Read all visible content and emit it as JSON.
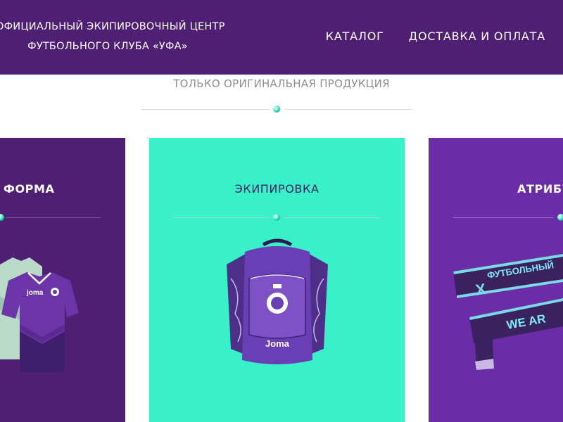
{
  "header": {
    "tagline_line1": "ОФИЦИАЛЬНЫЙ ЭКИПИРОВОЧНЫЙ ЦЕНТР",
    "tagline_line2": "ФУТБОЛЬНОГО КЛУБА «УФА»",
    "nav": [
      {
        "label": "КАТАЛОГ"
      },
      {
        "label": "ДОСТАВКА И ОПЛАТА"
      }
    ]
  },
  "section": {
    "subtitle": "ТОЛЬКО ОРИГИНАЛЬНАЯ ПРОДУКЦИЯ"
  },
  "cards": [
    {
      "title": "ФОРМА",
      "color": "#4f1f73"
    },
    {
      "title": "ЭКИПИРОВКА",
      "color": "#38f1c8"
    },
    {
      "title": "АТРИБУ",
      "color": "#6b2da7"
    }
  ],
  "images": {
    "kit_brand": "joma",
    "backpack_brand": "Joma",
    "scarf_text_1": "ФУТБОЛЬНЫЙ",
    "scarf_text_2": "WE AR",
    "scarf_letter": "X"
  },
  "colors": {
    "header_bg": "#4e1f72",
    "accent_mint": "#38f1c8",
    "purple_dark": "#4f1f73",
    "purple_light": "#6b2da7"
  }
}
